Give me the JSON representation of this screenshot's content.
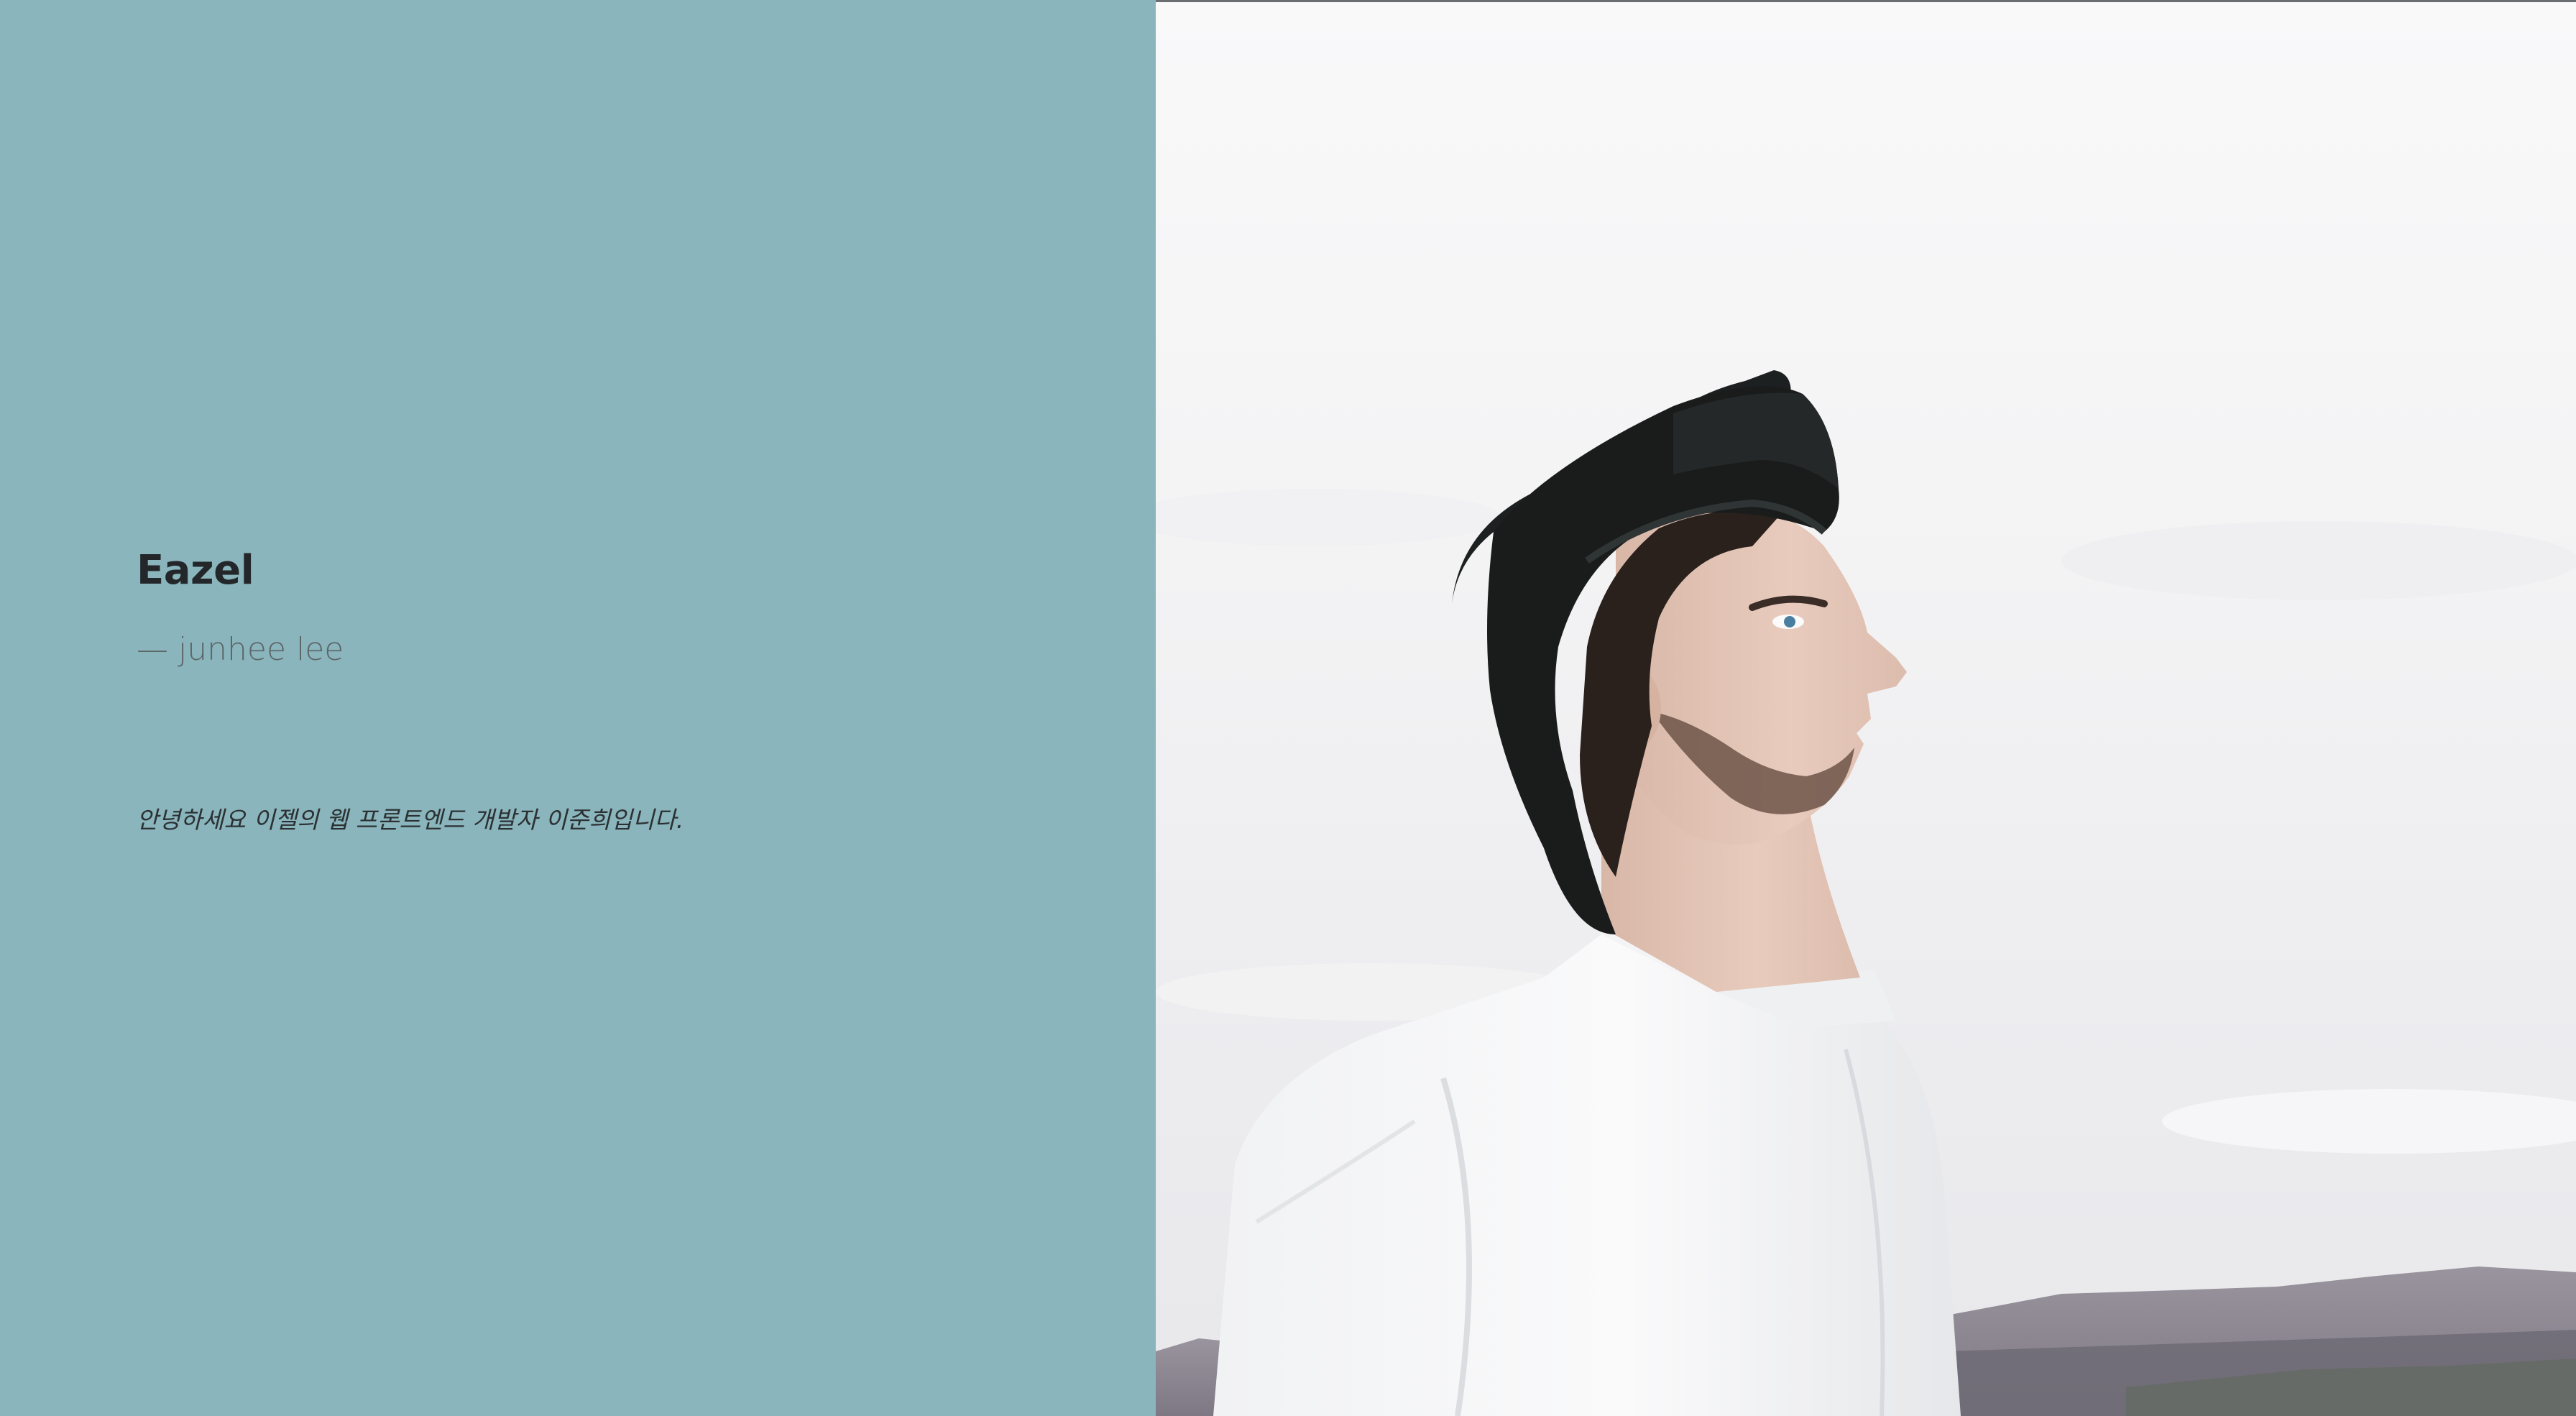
{
  "hero": {
    "title": "Eazel",
    "author": "— junhee lee",
    "greeting": "안녕하세요 이젤의 웹 프론트엔드 개발자 이준희입니다."
  },
  "colors": {
    "left_panel_background": "#8ab5bc",
    "title_text": "#23272a",
    "author_text": "#5c6668",
    "greeting_text": "#2b3133",
    "sky": "#f5f5f6"
  },
  "photo": {
    "icon": "portrait-photo-icon"
  }
}
